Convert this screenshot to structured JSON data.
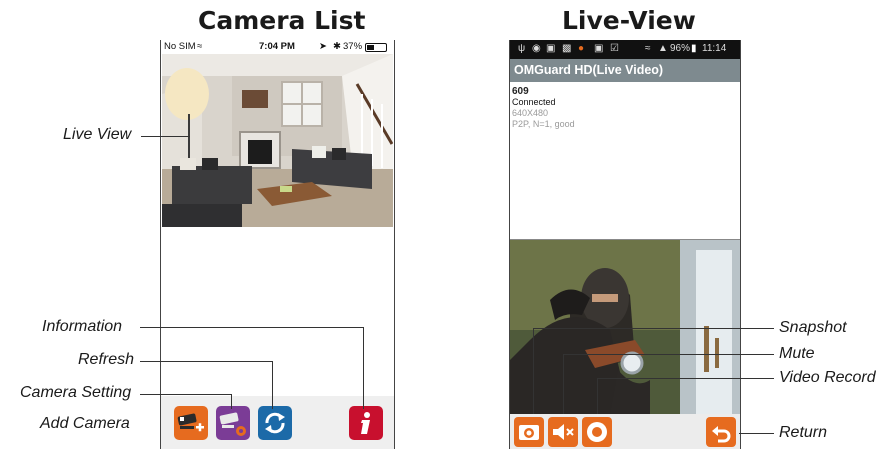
{
  "headings": {
    "camera_list": "Camera List",
    "live_view": "Live-View"
  },
  "camera_list_phone": {
    "status_bar": {
      "carrier": "No SIM",
      "time": "7:04 PM",
      "battery": "37%"
    },
    "toolbar_icons": [
      "add-camera-icon",
      "camera-setting-icon",
      "refresh-icon",
      "information-icon"
    ]
  },
  "live_view_phone": {
    "status_bar": {
      "battery": "96%",
      "time": "11:14"
    },
    "title": "OMGuard HD(Live Video)",
    "camera": {
      "name": "609",
      "status": "Connected",
      "resolution": "640X480",
      "connection": "P2P, N=1, good"
    },
    "toolbar_icons": [
      "snapshot-icon",
      "mute-icon",
      "video-record-icon",
      "return-icon"
    ]
  },
  "callouts": {
    "live_view": "Live View",
    "information": "Information",
    "refresh": "Refresh",
    "camera_setting": "Camera Setting",
    "add_camera": "Add Camera",
    "snapshot": "Snapshot",
    "mute": "Mute",
    "video_record": "Video Record",
    "return": "Return"
  },
  "colors": {
    "orange": "#e66b1f",
    "refresh_blue": "#1c6aa8",
    "info_red": "#c8102e",
    "purple": "#7b3c96",
    "title_bar": "#7e8a8f"
  }
}
